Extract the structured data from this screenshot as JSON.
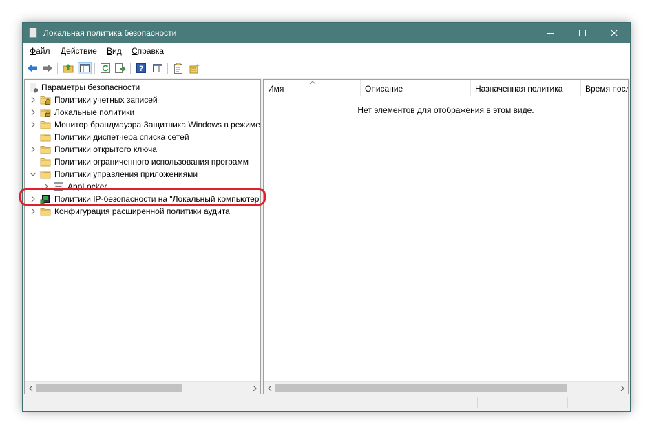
{
  "window": {
    "title": "Локальная политика безопасности",
    "controls": {
      "minimize": "minimize",
      "maximize": "maximize",
      "close": "close"
    }
  },
  "menu": [
    {
      "label": "Файл",
      "accel": "Ф",
      "rest": "айл"
    },
    {
      "label": "Действие",
      "accel": "Д",
      "rest": "ействие"
    },
    {
      "label": "Вид",
      "accel": "В",
      "rest": "ид"
    },
    {
      "label": "Справка",
      "accel": "С",
      "rest": "правка"
    }
  ],
  "toolbar": {
    "buttons": [
      "back-icon",
      "forward-icon",
      "up-folder-icon",
      "show-hide-tree-icon",
      "refresh-icon",
      "export-list-icon",
      "help-icon",
      "show-hide-action-pane-icon",
      "properties-icon",
      "new-policy-icon"
    ]
  },
  "tree": {
    "root": {
      "label": "Параметры безопасности"
    },
    "items": [
      {
        "label": "Политики учетных записей"
      },
      {
        "label": "Локальные политики"
      },
      {
        "label": "Монитор брандмауэра Защитника Windows в режиме"
      },
      {
        "label": "Политики диспетчера списка сетей"
      },
      {
        "label": "Политики открытого ключа"
      },
      {
        "label": "Политики ограниченного использования программ"
      },
      {
        "label": "Политики управления приложениями"
      },
      {
        "label": "AppLocker"
      },
      {
        "label": "Политики IP-безопасности на \"Локальный компьютер\""
      },
      {
        "label": "Конфигурация расширенной политики аудита"
      }
    ]
  },
  "list": {
    "columns": [
      {
        "label": "Имя"
      },
      {
        "label": "Описание"
      },
      {
        "label": "Назначенная политика"
      },
      {
        "label": "Время последнего изменения"
      }
    ],
    "empty_message": "Нет элементов для отображения в этом виде."
  },
  "colors": {
    "titlebar": "#4a7b7b",
    "highlight": "#e0202a",
    "folder": "#f7d774"
  }
}
